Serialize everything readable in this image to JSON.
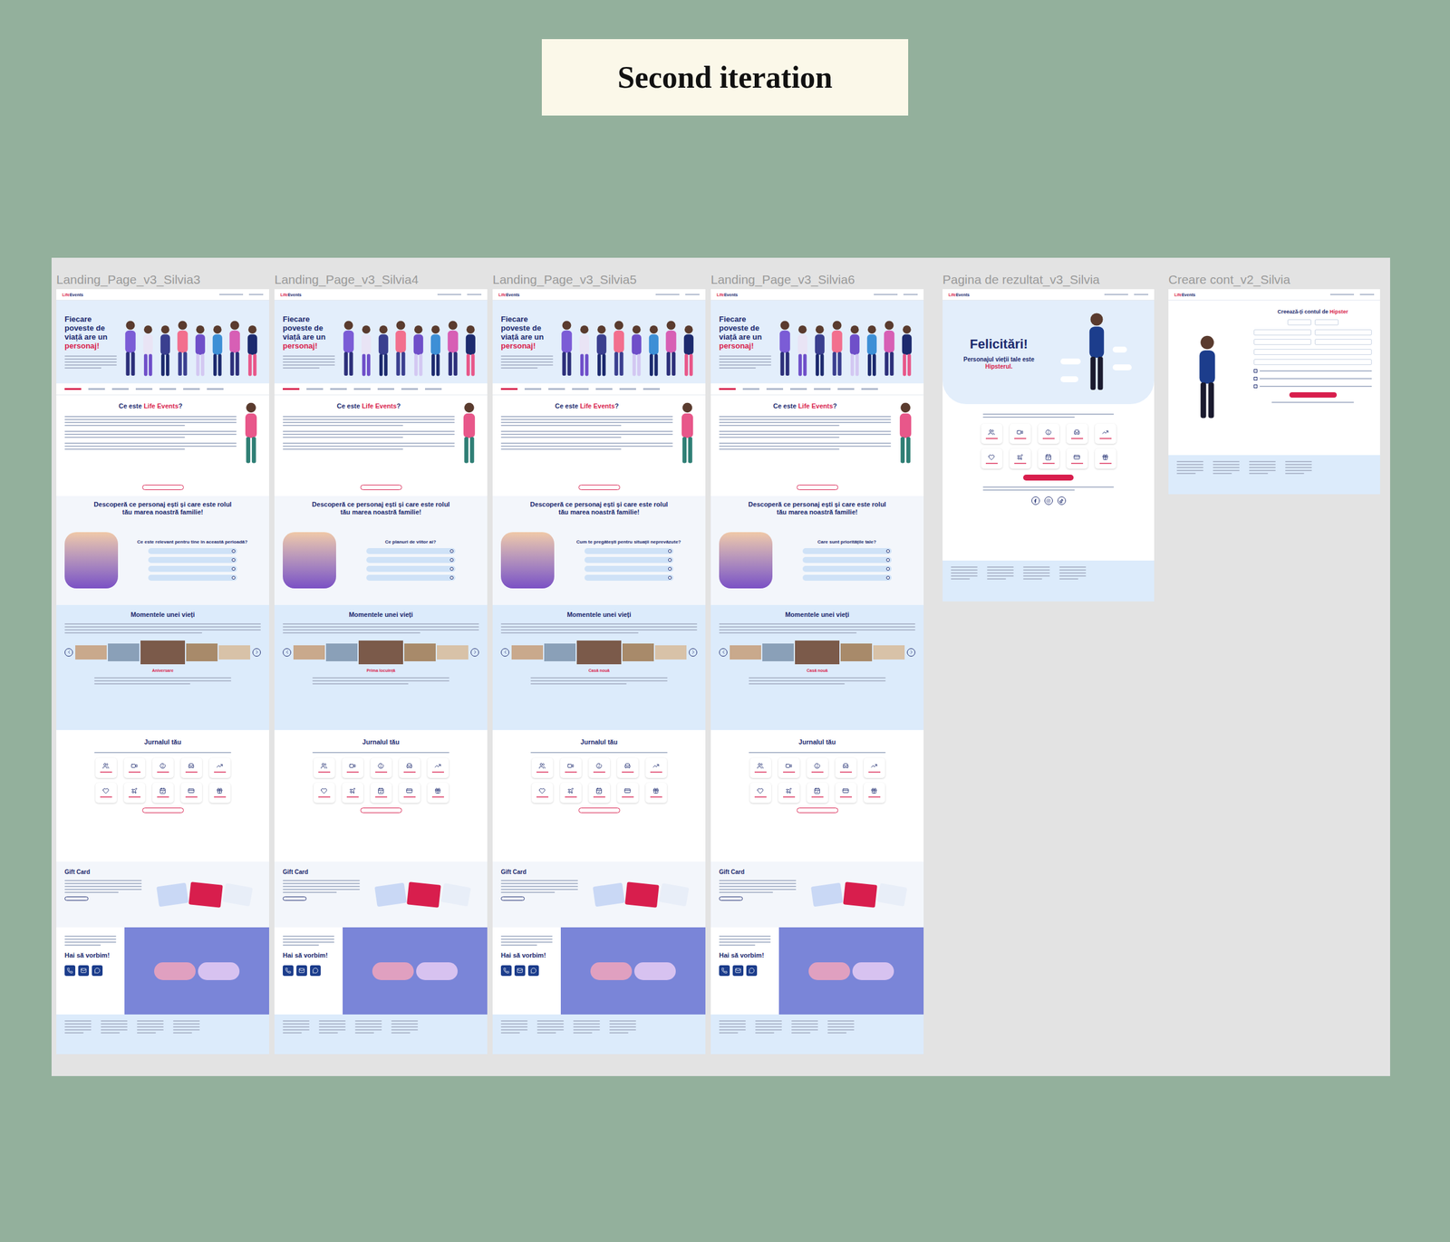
{
  "title": "Second iteration",
  "frames": [
    {
      "label": "Landing_Page_v3_Silvia3",
      "quiz_question": "Ce este relevant pentru tine în această perioadă?",
      "moment_caption": "Aniversare"
    },
    {
      "label": "Landing_Page_v3_Silvia4",
      "quiz_question": "Ce planuri de viitor ai?",
      "moment_caption": "Prima locuință"
    },
    {
      "label": "Landing_Page_v3_Silvia5",
      "quiz_question": "Cum te pregătești pentru situații neprevăzute?",
      "moment_caption": "Casă nouă"
    },
    {
      "label": "Landing_Page_v3_Silvia6",
      "quiz_question": "Care sunt prioritățile tale?",
      "moment_caption": "Casă nouă"
    }
  ],
  "landing": {
    "logo_a": "Life",
    "logo_b": "Events",
    "hero_title": "Fiecare poveste de viață are un ",
    "hero_highlight": "personaj!",
    "tabs": [
      {
        "selected": true
      },
      {
        "selected": false
      },
      {
        "selected": false
      },
      {
        "selected": false
      },
      {
        "selected": false
      },
      {
        "selected": false
      },
      {
        "selected": false
      }
    ],
    "about_pre": "Ce este ",
    "about_highlight": "Life Events",
    "about_post": "?",
    "quiz_title": "Descoperă ce personaj ești și care este rolul tău marea noastră familie!",
    "quiz_options": [
      {
        "selected": false
      },
      {
        "selected": false
      },
      {
        "selected": false
      },
      {
        "selected": false
      }
    ],
    "moments_title": "Momentele unei vieți",
    "journal_title": "Jurnalul tău",
    "gift_title": "Gift Card",
    "talk_title": "Hai să vorbim!"
  },
  "result": {
    "label": "Pagina de rezultat_v3_Silvia",
    "title": "Felicitări!",
    "subtitle": "Personajul vieții tale este ",
    "highlight": "Hipsterul."
  },
  "signup": {
    "label": "Creare cont_v2_Silvia",
    "title": "Creează-ți contul de ",
    "highlight": "Hipster",
    "checkboxes": [
      {
        "checked": false
      },
      {
        "checked": false
      },
      {
        "checked": false
      }
    ]
  }
}
